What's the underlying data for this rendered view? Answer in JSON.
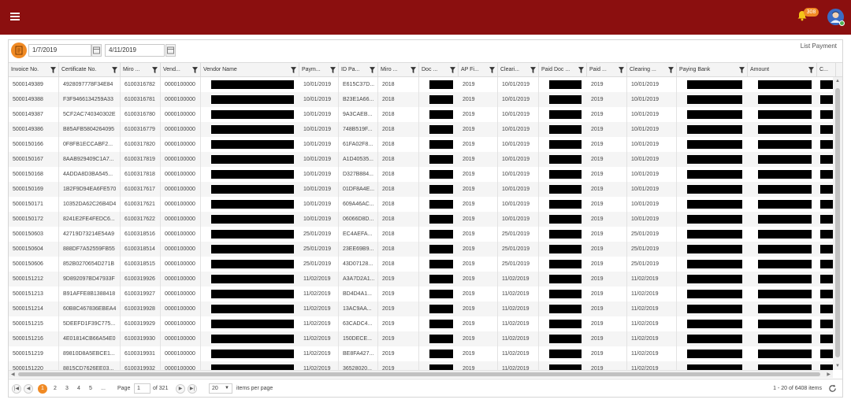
{
  "header": {
    "notification_count": "308"
  },
  "toolbar": {
    "from_date": "1/7/2019",
    "to_date": "4/11/2019",
    "title": "List Payment"
  },
  "columns": [
    "Invoice No.",
    "Certificate No.",
    "Miro ...",
    "Vend...",
    "Vendor Name",
    "Paym...",
    "ID Pa...",
    "Miro ...",
    "Doc ...",
    "AP Fi...",
    "Cleari...",
    "Paid Doc ...",
    "Paid ...",
    "Clearing ...",
    "Paying Bank",
    "Amount",
    "C..."
  ],
  "rows": [
    [
      "5000149389",
      "4928097778F34E84",
      "6100316782",
      "0000100000",
      "10/01/2019",
      "E615C37D...",
      "2018",
      "2019",
      "10/01/2019",
      "2019",
      "10/01/2019"
    ],
    [
      "5000149388",
      "F3F9466134259A33",
      "6100316781",
      "0000100000",
      "10/01/2019",
      "B23E1A66...",
      "2018",
      "2019",
      "10/01/2019",
      "2019",
      "10/01/2019"
    ],
    [
      "5000149387",
      "5CF2AC740340302E",
      "6100316780",
      "0000100000",
      "10/01/2019",
      "9A3CAEB...",
      "2018",
      "2019",
      "10/01/2019",
      "2019",
      "10/01/2019"
    ],
    [
      "5000149386",
      "B85AFB5804264095",
      "6100316779",
      "0000100000",
      "10/01/2019",
      "748B519F...",
      "2018",
      "2019",
      "10/01/2019",
      "2019",
      "10/01/2019"
    ],
    [
      "5000150166",
      "0F8FB1ECCABF2...",
      "6100317820",
      "0000100000",
      "10/01/2019",
      "61FA02F8...",
      "2018",
      "2019",
      "10/01/2019",
      "2019",
      "10/01/2019"
    ],
    [
      "5000150167",
      "8AAB929409C1A7...",
      "6100317819",
      "0000100000",
      "10/01/2019",
      "A1D40535...",
      "2018",
      "2019",
      "10/01/2019",
      "2019",
      "10/01/2019"
    ],
    [
      "5000150168",
      "4ADDA8D3BA545...",
      "6100317818",
      "0000100000",
      "10/01/2019",
      "D327B884...",
      "2018",
      "2019",
      "10/01/2019",
      "2019",
      "10/01/2019"
    ],
    [
      "5000150169",
      "1B2F9D94EA6FE570",
      "6100317617",
      "0000100000",
      "10/01/2019",
      "01DF8A4E...",
      "2018",
      "2019",
      "10/01/2019",
      "2019",
      "10/01/2019"
    ],
    [
      "5000150171",
      "10352DA62C26B4D4",
      "6100317621",
      "0000100000",
      "10/01/2019",
      "609A46AC...",
      "2018",
      "2019",
      "10/01/2019",
      "2019",
      "10/01/2019"
    ],
    [
      "5000150172",
      "8241E2FE4FEDC6...",
      "6100317622",
      "0000100000",
      "10/01/2019",
      "06066D8D...",
      "2018",
      "2019",
      "10/01/2019",
      "2019",
      "10/01/2019"
    ],
    [
      "5000150603",
      "42719D73214E54A9",
      "6100318516",
      "0000100000",
      "25/01/2019",
      "EC4AEFA...",
      "2018",
      "2019",
      "25/01/2019",
      "2019",
      "25/01/2019"
    ],
    [
      "5000150604",
      "888DF7A52559FB55",
      "6100318514",
      "0000100000",
      "25/01/2019",
      "23EE69B9...",
      "2018",
      "2019",
      "25/01/2019",
      "2019",
      "25/01/2019"
    ],
    [
      "5000150606",
      "852B0270654D271B",
      "6100318515",
      "0000100000",
      "25/01/2019",
      "43D07128...",
      "2018",
      "2019",
      "25/01/2019",
      "2019",
      "25/01/2019"
    ],
    [
      "5000151212",
      "9D892097BD47933F",
      "6100319926",
      "0000100000",
      "11/02/2019",
      "A3A7D2A1...",
      "2019",
      "2019",
      "11/02/2019",
      "2019",
      "11/02/2019"
    ],
    [
      "5000151213",
      "B91AFFE8B1388418",
      "6100319927",
      "0000100000",
      "11/02/2019",
      "BD4D4A1...",
      "2019",
      "2019",
      "11/02/2019",
      "2019",
      "11/02/2019"
    ],
    [
      "5000151214",
      "60B8C467836EBEA4",
      "6100319928",
      "0000100000",
      "11/02/2019",
      "13AC9AA...",
      "2019",
      "2019",
      "11/02/2019",
      "2019",
      "11/02/2019"
    ],
    [
      "5000151215",
      "5DEEFD1F39C775...",
      "6100319929",
      "0000100000",
      "11/02/2019",
      "63CADC4...",
      "2019",
      "2019",
      "11/02/2019",
      "2019",
      "11/02/2019"
    ],
    [
      "5000151216",
      "4E01814CB66A54E0",
      "6100319930",
      "0000100000",
      "11/02/2019",
      "150DECE...",
      "2019",
      "2019",
      "11/02/2019",
      "2019",
      "11/02/2019"
    ],
    [
      "5000151219",
      "89810D8A5EBCE1...",
      "6100319931",
      "0000100000",
      "11/02/2019",
      "BE8FA427...",
      "2019",
      "2019",
      "11/02/2019",
      "2019",
      "11/02/2019"
    ],
    [
      "5000151220",
      "8815CD7626EE03...",
      "6100319932",
      "0000100000",
      "11/02/2019",
      "36528020...",
      "2019",
      "2019",
      "11/02/2019",
      "2019",
      "11/02/2019"
    ]
  ],
  "pager": {
    "pages": [
      "1",
      "2",
      "3",
      "4",
      "5",
      "..."
    ],
    "page_label": "Page",
    "current_page": "1",
    "of_total": "of 321",
    "page_size": "20",
    "items_per_page": "items per page",
    "summary": "1 - 20 of 6408 items"
  },
  "colors": {
    "header_bg": "#8b0f0f",
    "accent": "#f08a24"
  }
}
